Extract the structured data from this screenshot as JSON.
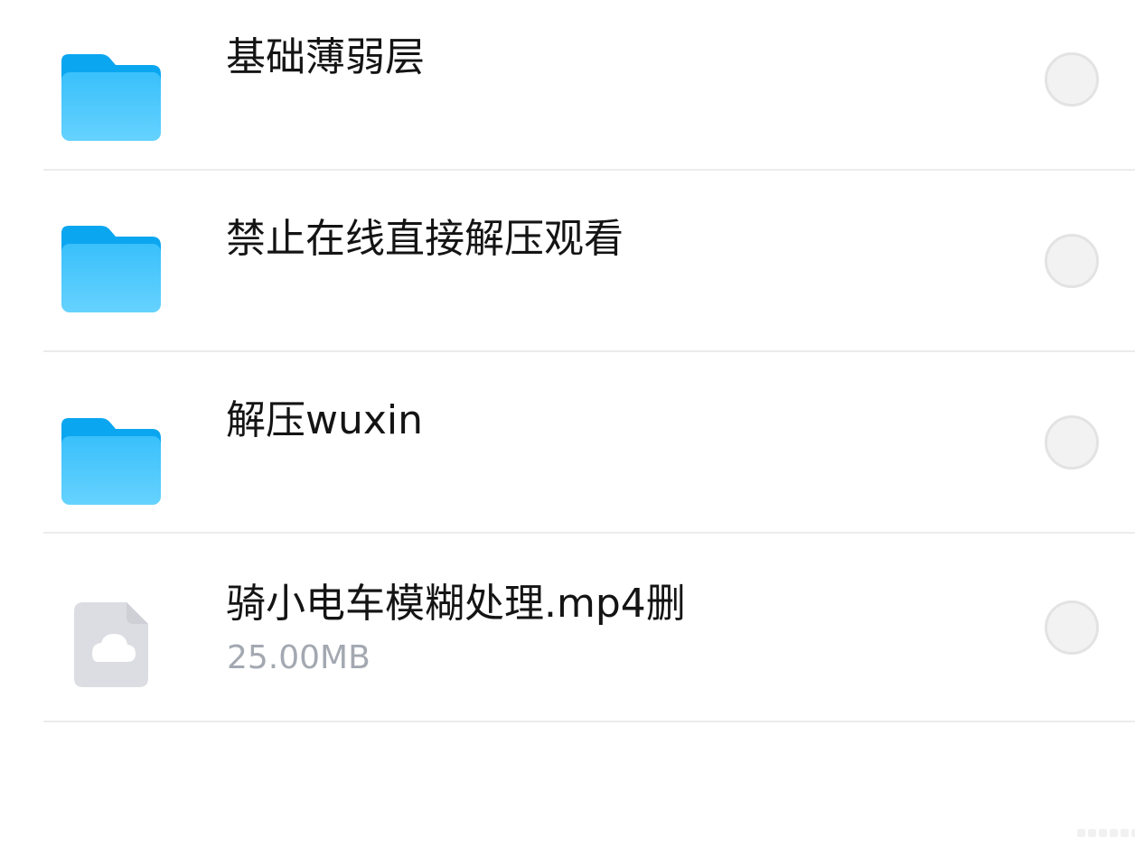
{
  "files": [
    {
      "name": "基础薄弱层",
      "type": "folder",
      "icon": "folder-icon",
      "size": ""
    },
    {
      "name": "禁止在线直接解压观看",
      "type": "folder",
      "icon": "folder-icon",
      "size": ""
    },
    {
      "name": "解压wuxin",
      "type": "folder",
      "icon": "folder-icon",
      "size": ""
    },
    {
      "name": "骑小电车模糊处理.mp4删",
      "type": "file",
      "icon": "cloud-file-icon",
      "size": "25.00MB"
    }
  ],
  "colors": {
    "folder_tab": "#0ba6f0",
    "folder_body_top": "#39c0fb",
    "folder_body_bottom": "#66d2fe",
    "file_icon_bg": "#dcdde2",
    "text_primary": "#141414",
    "text_secondary": "#a3a8b1",
    "divider": "#ececec",
    "radio_fill": "#f2f2f2",
    "radio_border": "#e3e3e3"
  }
}
